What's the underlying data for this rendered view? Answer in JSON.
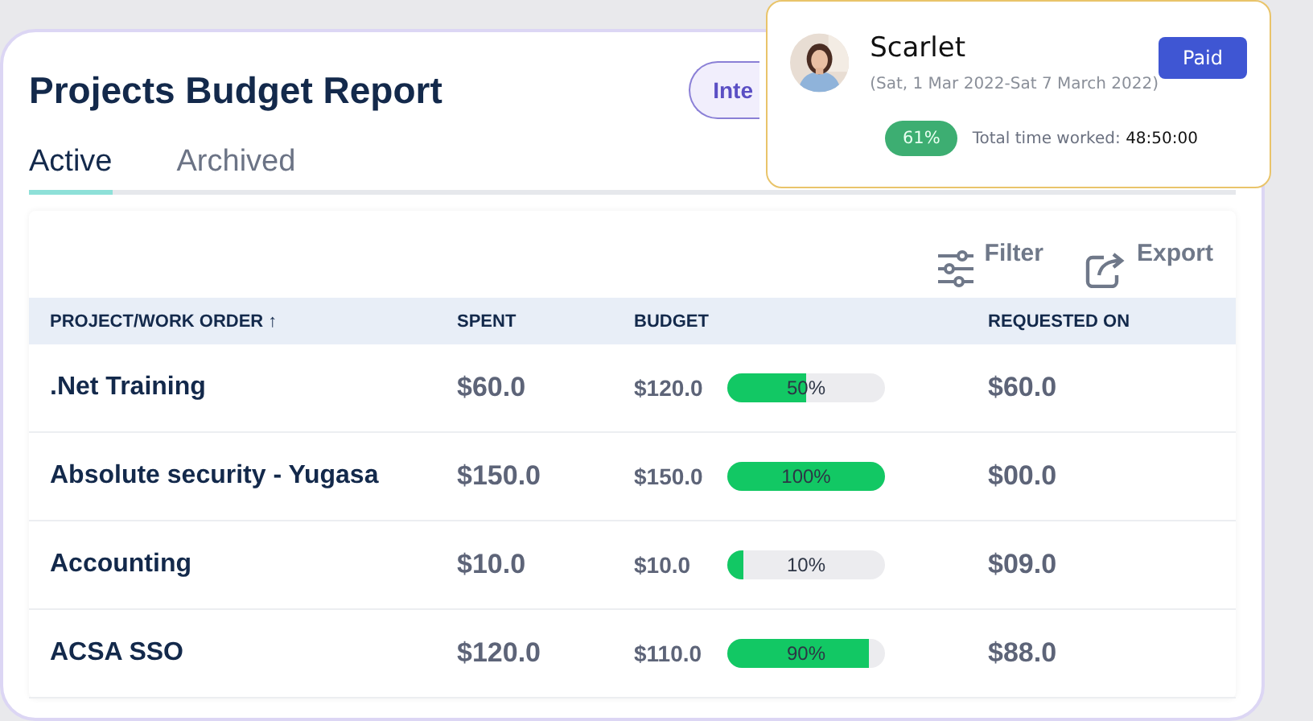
{
  "header": {
    "title": "Projects Budget Report",
    "pill_button": "Inte"
  },
  "tabs": [
    {
      "label": "Active",
      "selected": true
    },
    {
      "label": "Archived",
      "selected": false
    }
  ],
  "toolbar": [
    {
      "kind": "filter",
      "label": "Filter"
    },
    {
      "kind": "export",
      "label": "Export"
    }
  ],
  "table": {
    "columns": [
      {
        "label": "PROJECT/WORK ORDER",
        "sort": "↑"
      },
      {
        "label": "SPENT"
      },
      {
        "label": "BUDGET"
      },
      {
        "label": "REQUESTED ON"
      }
    ],
    "rows": [
      {
        "project": ".Net Training",
        "spent": "$60.0",
        "budget": "$120.0",
        "level": 0.5,
        "percent": "50%",
        "requested": "$60.0"
      },
      {
        "project": "Absolute security - Yugasa",
        "spent": "$150.0",
        "budget": "$150.0",
        "level": 1.0,
        "percent": "100%",
        "requested": "$00.0"
      },
      {
        "project": "Accounting",
        "spent": "$10.0",
        "budget": "$10.0",
        "level": 0.1,
        "percent": "10%",
        "requested": "$09.0"
      },
      {
        "project": "ACSA SSO",
        "spent": "$120.0",
        "budget": "$110.0",
        "level": 0.9,
        "percent": "90%",
        "requested": "$88.0"
      }
    ]
  },
  "popup": {
    "name": "Scarlet",
    "date_range": "(Sat, 1 Mar 2022-Sat 7 March 2022)",
    "status_button": "Paid",
    "percent_badge": "61%",
    "time_label": "Total time worked:",
    "time_value": "48:50:00"
  }
}
